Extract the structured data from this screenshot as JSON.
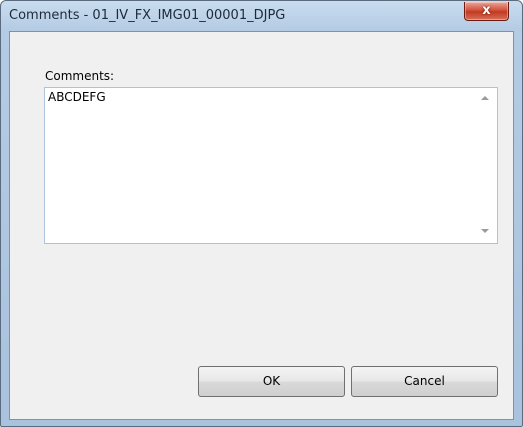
{
  "window": {
    "title": "Comments - 01_IV_FX_IMG01_00001_DJPG",
    "close_glyph": "x"
  },
  "form": {
    "comments_label": "Comments:",
    "comments_value": "ABCDEFG"
  },
  "buttons": {
    "ok_label": "OK",
    "cancel_label": "Cancel"
  },
  "colors": {
    "titlebar": "#b9d1ea",
    "close_button": "#c84b32",
    "client_background": "#f0f0f0"
  },
  "icons": {
    "close": "close-icon",
    "scroll_up": "scroll-up-arrow-icon",
    "scroll_down": "scroll-down-arrow-icon"
  }
}
